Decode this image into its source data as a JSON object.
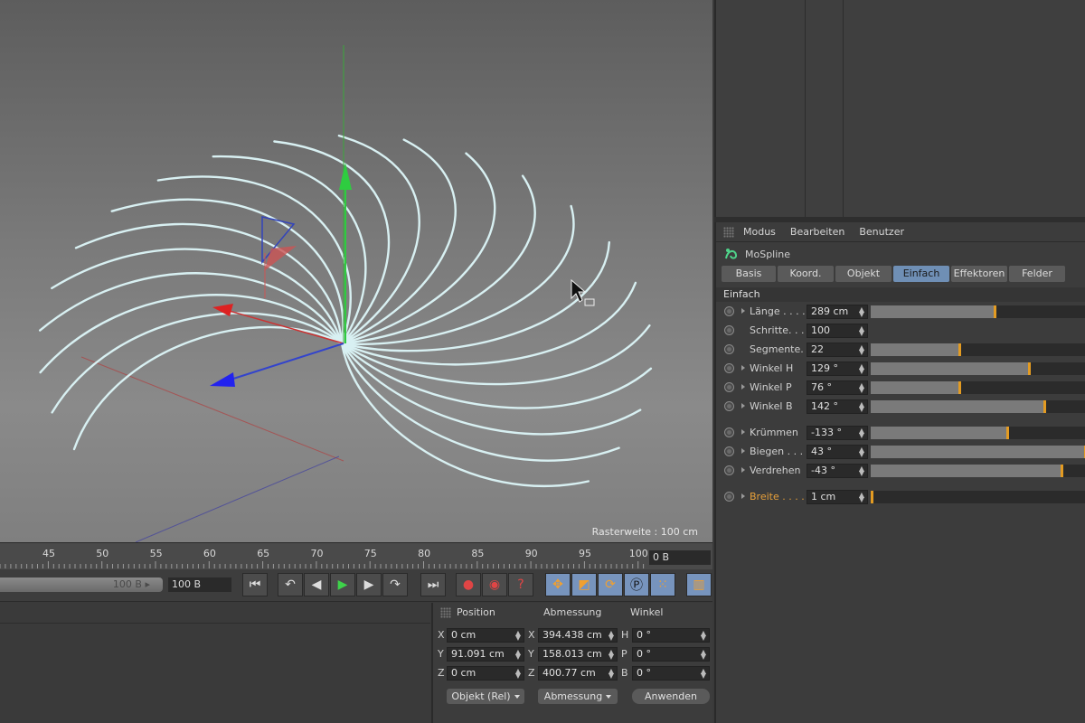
{
  "viewport": {
    "grid_label": "Rasterweite : 100 cm"
  },
  "attributes": {
    "menu": [
      "Modus",
      "Bearbeiten",
      "Benutzer"
    ],
    "object_name": "MoSpline",
    "tabs": [
      "Basis",
      "Koord.",
      "Objekt",
      "Einfach",
      "Effektoren",
      "Felder"
    ],
    "active_tab": "Einfach",
    "section_title": "Einfach",
    "params": [
      {
        "label": "Länge . . . .",
        "value": "289 cm",
        "slider": 0.58,
        "has_slider": true,
        "expandable": true
      },
      {
        "label": "Schritte. . . .",
        "value": "100",
        "has_slider": false,
        "expandable": false
      },
      {
        "label": "Segmente. . .",
        "value": "22",
        "slider": 0.42,
        "has_slider": true,
        "expandable": false
      },
      {
        "label": "Winkel H",
        "value": "129 °",
        "slider": 0.74,
        "has_slider": true,
        "expandable": true
      },
      {
        "label": "Winkel P",
        "value": "76 °",
        "slider": 0.42,
        "has_slider": true,
        "expandable": true
      },
      {
        "label": "Winkel B",
        "value": "142 °",
        "slider": 0.81,
        "has_slider": true,
        "expandable": true
      },
      {
        "label": "Krümmen",
        "value": "-133 °",
        "slider": 0.64,
        "has_slider": true,
        "expandable": true
      },
      {
        "label": "Biegen . . .",
        "value": "43 °",
        "slider": 1.0,
        "has_slider": true,
        "expandable": true
      },
      {
        "label": "Verdrehen",
        "value": "-43 °",
        "slider": 0.89,
        "has_slider": true,
        "expandable": true
      },
      {
        "label": "Breite . . . .",
        "value": "1 cm",
        "slider": 0.01,
        "has_slider": true,
        "expandable": true,
        "highlight": true
      }
    ]
  },
  "timeline": {
    "ticks": [
      "45",
      "50",
      "55",
      "60",
      "65",
      "70",
      "75",
      "80",
      "85",
      "90",
      "95",
      "100"
    ],
    "current_frame": "0 B"
  },
  "transport": {
    "range_value": "100 B",
    "end_value": "100 B"
  },
  "coords": {
    "headers": [
      "Position",
      "Abmessung",
      "Winkel"
    ],
    "rows": [
      {
        "pos_axis": "X",
        "pos": "0 cm",
        "size_axis": "X",
        "size": "394.438 cm",
        "rot_axis": "H",
        "rot": "0 °"
      },
      {
        "pos_axis": "Y",
        "pos": "91.091 cm",
        "size_axis": "Y",
        "size": "158.013 cm",
        "rot_axis": "P",
        "rot": "0 °"
      },
      {
        "pos_axis": "Z",
        "pos": "0 cm",
        "size_axis": "Z",
        "size": "400.77 cm",
        "rot_axis": "B",
        "rot": "0 °"
      }
    ],
    "mode_dropdown": "Objekt (Rel)",
    "size_dropdown": "Abmessung",
    "apply_button": "Anwenden"
  },
  "colors": {
    "accent": "#e39b22",
    "tab_active": "#6f8fb5",
    "spline": "#d8f0f2"
  }
}
